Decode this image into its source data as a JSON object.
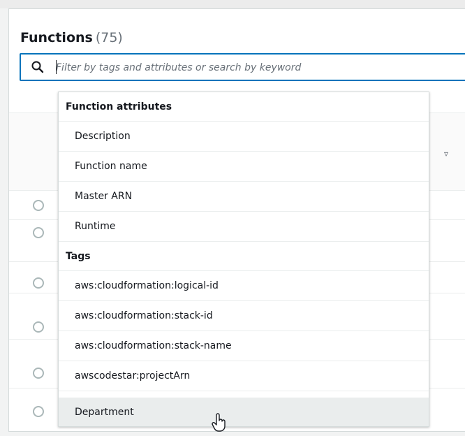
{
  "header": {
    "title": "Functions",
    "count": "(75)"
  },
  "search": {
    "placeholder": "Filter by tags and attributes or search by keyword",
    "icon": "search-icon"
  },
  "dropdown": {
    "groups": [
      {
        "label": "Function attributes",
        "options": [
          "Description",
          "Function name",
          "Master ARN",
          "Runtime"
        ]
      },
      {
        "label": "Tags",
        "options": [
          "aws:cloudformation:logical-id",
          "aws:cloudformation:stack-id",
          "aws:cloudformation:stack-name",
          "awscodestar:projectArn",
          "Department"
        ]
      }
    ],
    "highlighted": "Department"
  },
  "colors": {
    "accent": "#0073bb",
    "highlight": "#eaeded"
  }
}
